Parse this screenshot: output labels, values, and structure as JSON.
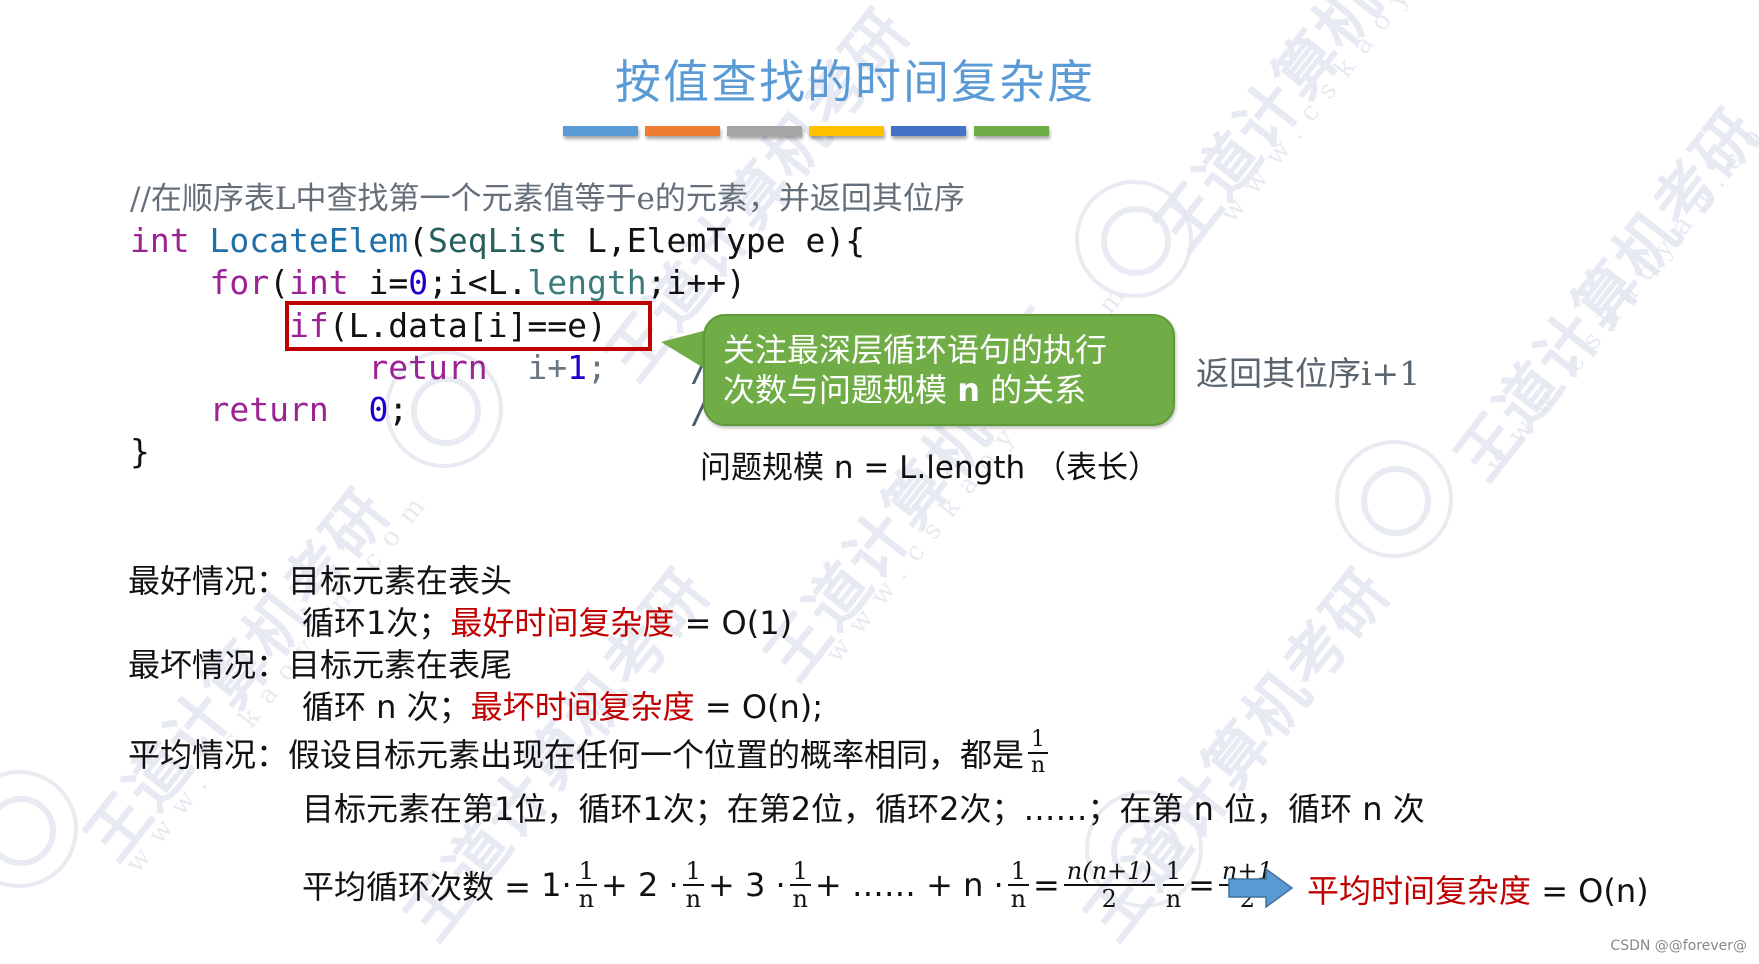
{
  "slide": {
    "title": "按值查找的时间复杂度",
    "title_color": "#5b9bd5",
    "bar_colors": [
      "#5b9bd5",
      "#ed7d31",
      "#a5a5a5",
      "#ffc000",
      "#4472c4",
      "#70ad47"
    ]
  },
  "watermark": {
    "brand": "王道计算机考研",
    "url": "www.cskaoyan.com"
  },
  "code": {
    "comment": "//在顺序表L中查找第一个元素值等于e的元素，并返回其位序",
    "line1": {
      "kw": "int",
      "fn": "LocateElem",
      "open": "(",
      "ty": "SeqList",
      "rest": " L,ElemType e){"
    },
    "line2": {
      "kw": "for",
      "open": "(",
      "kw2": "int",
      "init": " i=",
      "zero": "0",
      "cond": ";i<L.",
      "mem": "length",
      "inc": ";i++)"
    },
    "line3": {
      "kw": "if",
      "rest": "(L.data[i]==e)"
    },
    "line4": {
      "kw": "return",
      "expr": "i+",
      "one": "1",
      "semi": ";"
    },
    "line5": {
      "kw": "return",
      "zero": "0",
      "semi": ";"
    },
    "line6": "}"
  },
  "callout": {
    "line1": "关注最深层循环语句的执行",
    "line2_prefix": "次数与问题规模 ",
    "line2_n": "n",
    "line2_suffix": " 的关系",
    "color": "#70ad47"
  },
  "side_note": "返回其位序i+1",
  "problem_size": "问题规模 n = L.length （表长）",
  "analysis": {
    "best_label": "最好情况：",
    "best_case": "目标元素在表头",
    "best_loop": "循环1次；",
    "best_term": "最好时间复杂度",
    "best_result": " = O(1)",
    "worst_label": "最坏情况：",
    "worst_case": "目标元素在表尾",
    "worst_loop": "循环 n 次；",
    "worst_term": "最坏时间复杂度",
    "worst_result": " = O(n);",
    "avg_label": "平均情况：",
    "avg_assume": "假设目标元素出现在任何一个位置的概率相同，都是",
    "avg_prob_num": "1",
    "avg_prob_den": "n",
    "avg_positions": "目标元素在第1位，循环1次；在第2位，循环2次；……；在第 n 位，循环 n 次",
    "formula": {
      "label": "平均循环次数 = ",
      "t1": "1·",
      "t2": "+ 2 ·",
      "t3": "+ 3 ·",
      "t4": "+ …… + n ·",
      "eq": "=",
      "one": "1",
      "n": "n",
      "sum_num": "n(n+1)",
      "two": "2",
      "res_num": "n+1"
    },
    "avg_term": "平均时间复杂度",
    "avg_result": " = O(n)"
  },
  "footer": "CSDN @@forever@"
}
